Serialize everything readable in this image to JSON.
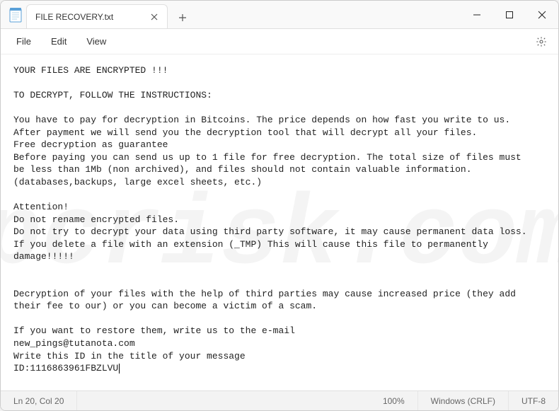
{
  "titlebar": {
    "tab_title": "FILE RECOVERY.txt"
  },
  "menu": {
    "file": "File",
    "edit": "Edit",
    "view": "View"
  },
  "content": {
    "text": "YOUR FILES ARE ENCRYPTED !!!\n\nTO DECRYPT, FOLLOW THE INSTRUCTIONS:\n\nYou have to pay for decryption in Bitcoins. The price depends on how fast you write to us.\nAfter payment we will send you the decryption tool that will decrypt all your files.\nFree decryption as guarantee\nBefore paying you can send us up to 1 file for free decryption. The total size of files must\nbe less than 1Mb (non archived), and files should not contain valuable information.\n(databases,backups, large excel sheets, etc.)\n\nAttention!\nDo not rename encrypted files.\nDo not try to decrypt your data using third party software, it may cause permanent data loss.\nIf you delete a file with an extension (_TMP) This will cause this file to permanently\ndamage!!!!!\n\n\nDecryption of your files with the help of third parties may cause increased price (they add\ntheir fee to our) or you can become a victim of a scam.\n\nIf you want to restore them, write us to the e-mail\nnew_pings@tutanota.com\nWrite this ID in the title of your message\nID:1116863961FBZLVU"
  },
  "statusbar": {
    "position": "Ln 20, Col 20",
    "zoom": "100%",
    "line_ending": "Windows (CRLF)",
    "encoding": "UTF-8"
  },
  "watermark": "pcrisk.com"
}
